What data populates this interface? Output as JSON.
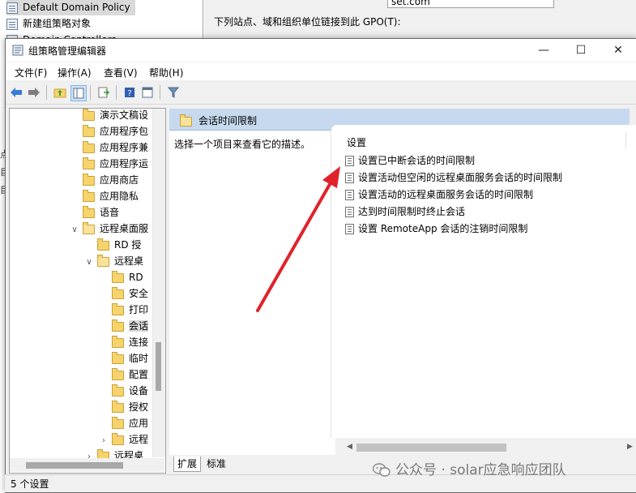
{
  "background_window": {
    "tree_items": [
      "Default Domain Policy",
      "新建组策略对象",
      "Domain Controllers"
    ],
    "field_value": "set.com",
    "link_label": "下列站点、域和组织单位链接到此 GPO(T):",
    "edge_chars": [
      "点",
      "目",
      "目"
    ]
  },
  "window": {
    "title": "组策略管理编辑器",
    "buttons": {
      "minimize": "—",
      "maximize": "☐",
      "close": "✕"
    }
  },
  "menu": {
    "file": "文件(F)",
    "action": "操作(A)",
    "view": "查看(V)",
    "help": "帮助(H)"
  },
  "tree": {
    "items": [
      {
        "label": "演示文稿设",
        "depth": 0,
        "expander": ""
      },
      {
        "label": "应用程序包",
        "depth": 0,
        "expander": ""
      },
      {
        "label": "应用程序兼",
        "depth": 0,
        "expander": ""
      },
      {
        "label": "应用程序运",
        "depth": 0,
        "expander": ""
      },
      {
        "label": "应用商店",
        "depth": 0,
        "expander": ""
      },
      {
        "label": "应用隐私",
        "depth": 0,
        "expander": ""
      },
      {
        "label": "语音",
        "depth": 0,
        "expander": ""
      },
      {
        "label": "远程桌面服",
        "depth": 0,
        "expander": "∨"
      },
      {
        "label": "RD 授",
        "depth": 1,
        "expander": ""
      },
      {
        "label": "远程桌",
        "depth": 1,
        "expander": "∨"
      },
      {
        "label": "RD",
        "depth": 2,
        "expander": ""
      },
      {
        "label": "安全",
        "depth": 2,
        "expander": ""
      },
      {
        "label": "打印",
        "depth": 2,
        "expander": ""
      },
      {
        "label": "会话",
        "depth": 2,
        "expander": "",
        "selected": true
      },
      {
        "label": "连接",
        "depth": 2,
        "expander": ""
      },
      {
        "label": "临时",
        "depth": 2,
        "expander": ""
      },
      {
        "label": "配置",
        "depth": 2,
        "expander": ""
      },
      {
        "label": "设备",
        "depth": 2,
        "expander": ""
      },
      {
        "label": "授权",
        "depth": 2,
        "expander": ""
      },
      {
        "label": "应用",
        "depth": 2,
        "expander": ""
      },
      {
        "label": "远程",
        "depth": 2,
        "expander": "›"
      },
      {
        "label": "远程桌",
        "depth": 1,
        "expander": "›"
      }
    ]
  },
  "content": {
    "header": "会话时间限制",
    "description": "选择一个项目来查看它的描述。",
    "column_header": "设置",
    "settings": [
      "设置已中断会话的时间限制",
      "设置活动但空闲的远程桌面服务会话的时间限制",
      "设置活动的远程桌面服务会话的时间限制",
      "达到时间限制时终止会话",
      "设置 RemoteApp 会话的注销时间限制"
    ]
  },
  "tabs": {
    "extended": "扩展",
    "standard": "标准"
  },
  "status": {
    "count": "5 个设置"
  },
  "watermark": "公众号 · solar应急响应团队",
  "colors": {
    "header_bg": "#c6d9ee",
    "arrow": "#e0222a",
    "folder": "#f7d36b"
  }
}
